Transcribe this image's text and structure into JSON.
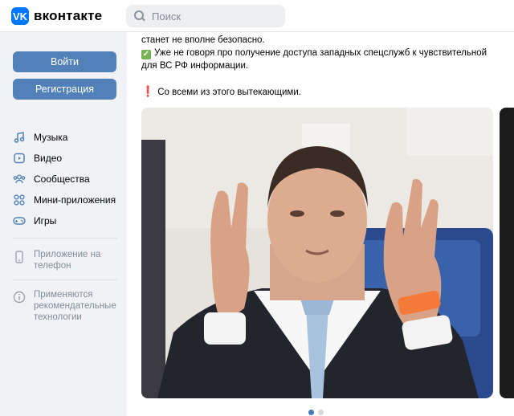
{
  "header": {
    "logo_mark": "VK",
    "logo_text": "вконтакте",
    "search_placeholder": "Поиск"
  },
  "sidebar": {
    "login_label": "Войти",
    "register_label": "Регистрация",
    "nav": [
      {
        "label": "Музыка",
        "icon": "music-icon"
      },
      {
        "label": "Видео",
        "icon": "video-icon"
      },
      {
        "label": "Сообщества",
        "icon": "communities-icon"
      },
      {
        "label": "Мини-приложения",
        "icon": "mini-apps-icon"
      },
      {
        "label": "Игры",
        "icon": "gamepad-icon"
      }
    ],
    "app_link": "Приложение на телефон",
    "recommend_link": "Применяются рекомендательные технологии"
  },
  "post": {
    "line1": "станет не вполне безопасно.",
    "check_line1": "Уже не говоря про получение доступа западных спецслужб к чувствительной",
    "check_line2": "для ВС РФ информации.",
    "excl_line": "Со всеми из этого вытекающими.",
    "check_emoji": "✓",
    "excl_emoji": "❗"
  },
  "carousel": {
    "pages": 2,
    "active": 1
  },
  "colors": {
    "accent": "#0077ff",
    "button": "#5181b8",
    "sidebar_bg": "#f0f2f5"
  }
}
